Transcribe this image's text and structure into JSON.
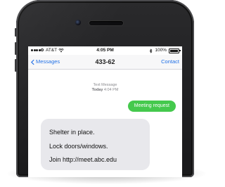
{
  "status_bar": {
    "carrier": "AT&T",
    "time": "4:05 PM",
    "battery": "100%"
  },
  "navbar": {
    "back_label": "Messages",
    "title": "433-62",
    "contact_label": "Contact"
  },
  "conversation": {
    "meta_line1": "Text Message",
    "meta_line2_day": "Today",
    "meta_line2_time": "4:04 PM",
    "sent_message": "Meeting request",
    "received_lines": [
      "Shelter in place.",
      "Lock doors/windows.",
      "Join http://meet.abc.edu"
    ]
  },
  "colors": {
    "accent_blue": "#1f6fe6",
    "sent_bubble": "#45c94d",
    "received_bubble": "#e8e8ec",
    "phone_body": "#1c1c1e"
  },
  "icons": {
    "signal": "signal-dots-icon",
    "wifi": "wifi-icon",
    "bluetooth": "bluetooth-icon",
    "battery": "battery-icon",
    "back": "chevron-left-icon"
  }
}
